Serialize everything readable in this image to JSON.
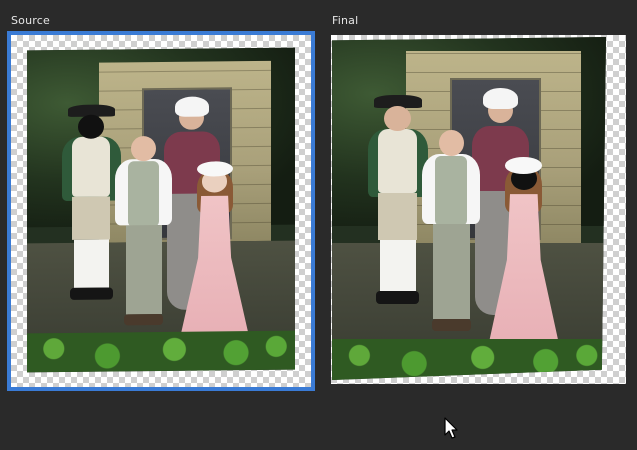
{
  "panels": {
    "source": {
      "label": "Source",
      "selected": true
    },
    "final": {
      "label": "Final",
      "selected": false
    }
  },
  "colors": {
    "background": "#2a2a2a",
    "selection_border": "#3a7bd5",
    "label_text": "#e6e6e6"
  },
  "icons": {
    "cursor": "arrow-pointer-icon"
  }
}
